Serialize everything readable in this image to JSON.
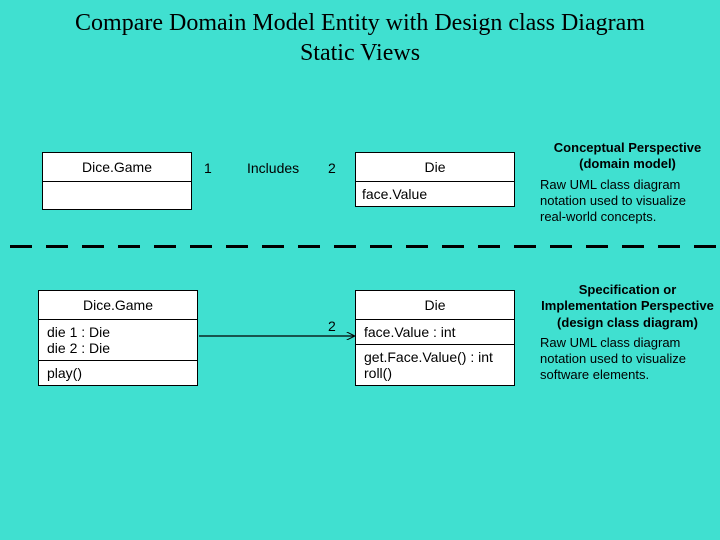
{
  "title": "Compare Domain Model Entity with Design class Diagram\nStatic Views",
  "top": {
    "left_class": {
      "name": "Dice.Game"
    },
    "right_class": {
      "name": "Die",
      "attribute": "face.Value"
    },
    "assoc": {
      "left_mult": "1",
      "label": "Includes",
      "right_mult": "2"
    },
    "side": {
      "heading": "Conceptual Perspective (domain model)",
      "body": "Raw UML class diagram notation used to visualize real-world concepts."
    }
  },
  "bottom": {
    "left_class": {
      "name": "Dice.Game",
      "attrs": [
        "die 1 : Die",
        "die 2 : Die"
      ],
      "ops": [
        "play()"
      ]
    },
    "right_class": {
      "name": "Die",
      "attrs": [
        "face.Value : int"
      ],
      "ops": [
        "get.Face.Value() : int",
        "roll()"
      ]
    },
    "assoc": {
      "right_mult": "2"
    },
    "side": {
      "heading": "Specification or Implementation Perspective (design class diagram)",
      "body": "Raw UML class diagram notation used to visualize software elements."
    }
  }
}
